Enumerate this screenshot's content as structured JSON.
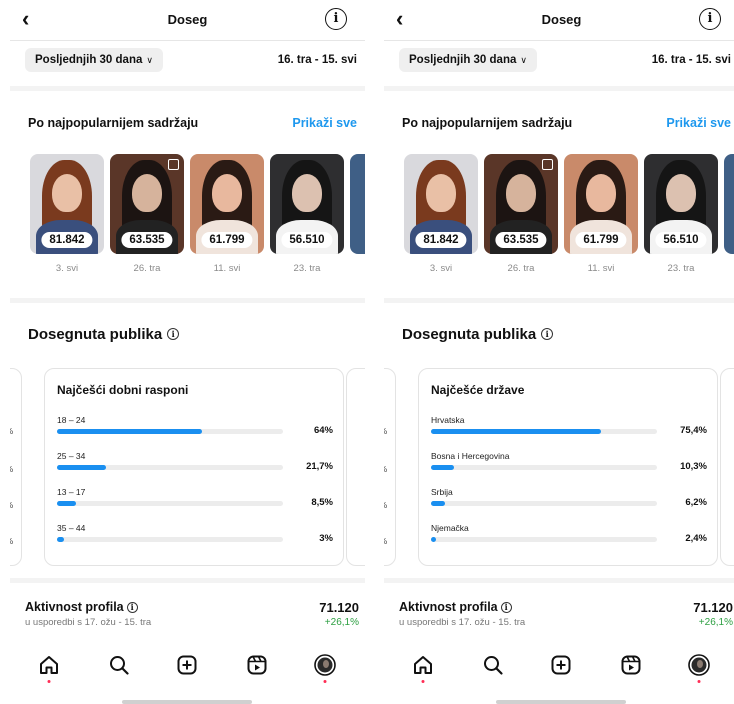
{
  "panels": [
    {
      "header": {
        "back_icon": "chevron-left-icon",
        "title": "Doseg",
        "info_icon": "info-icon"
      },
      "period": {
        "label": "Posljednjih 30 dana",
        "range": "16. tra - 15. svi"
      },
      "top_content": {
        "title": "Po najpopularnijem sadržaju",
        "show_all": "Prikaži sve",
        "items": [
          {
            "value": "81.842",
            "date": "3. svi"
          },
          {
            "value": "63.535",
            "date": "26. tra"
          },
          {
            "value": "61.799",
            "date": "11. svi"
          },
          {
            "value": "56.510",
            "date": "23. tra"
          }
        ]
      },
      "audience": {
        "title": "Dosegnuta publika",
        "card": {
          "title": "Najčešći dobni rasponi",
          "rows": [
            {
              "label": "18 – 24",
              "pct": "64%",
              "value": 0.64
            },
            {
              "label": "25 – 34",
              "pct": "21,7%",
              "value": 0.217
            },
            {
              "label": "13 – 17",
              "pct": "8,5%",
              "value": 0.085
            },
            {
              "label": "35 – 44",
              "pct": "3%",
              "value": 0.03
            }
          ]
        }
      },
      "activity": {
        "title": "Aktivnost profila",
        "subtitle": "u usporedbi s 17. ožu - 15. tra",
        "value": "71.120",
        "change": "+26,1%"
      },
      "nav": [
        "home-icon",
        "search-icon",
        "create-icon",
        "reels-icon",
        "profile-avatar"
      ]
    },
    {
      "header": {
        "back_icon": "chevron-left-icon",
        "title": "Doseg",
        "info_icon": "info-icon"
      },
      "period": {
        "label": "Posljednjih 30 dana",
        "range": "16. tra - 15. svi"
      },
      "top_content": {
        "title": "Po najpopularnijem sadržaju",
        "show_all": "Prikaži sve",
        "items": [
          {
            "value": "81.842",
            "date": "3. svi"
          },
          {
            "value": "63.535",
            "date": "26. tra"
          },
          {
            "value": "61.799",
            "date": "11. svi"
          },
          {
            "value": "56.510",
            "date": "23. tra"
          }
        ]
      },
      "audience": {
        "title": "Dosegnuta publika",
        "card": {
          "title": "Najčešće države",
          "rows": [
            {
              "label": "Hrvatska",
              "pct": "75,4%",
              "value": 0.754
            },
            {
              "label": "Bosna i Hercegovina",
              "pct": "10,3%",
              "value": 0.103
            },
            {
              "label": "Srbija",
              "pct": "6,2%",
              "value": 0.062
            },
            {
              "label": "Njemačka",
              "pct": "2,4%",
              "value": 0.024
            }
          ]
        }
      },
      "activity": {
        "title": "Aktivnost profila",
        "subtitle": "u usporedbi s 17. ožu - 15. tra",
        "value": "71.120",
        "change": "+26,1%"
      },
      "nav": [
        "home-icon",
        "search-icon",
        "create-icon",
        "reels-icon",
        "profile-avatar"
      ]
    }
  ],
  "colors": {
    "accent": "#1e98ee",
    "bar": "#1a8ff0",
    "positive": "#2ea043",
    "notification_dot": "#ff2d55"
  }
}
